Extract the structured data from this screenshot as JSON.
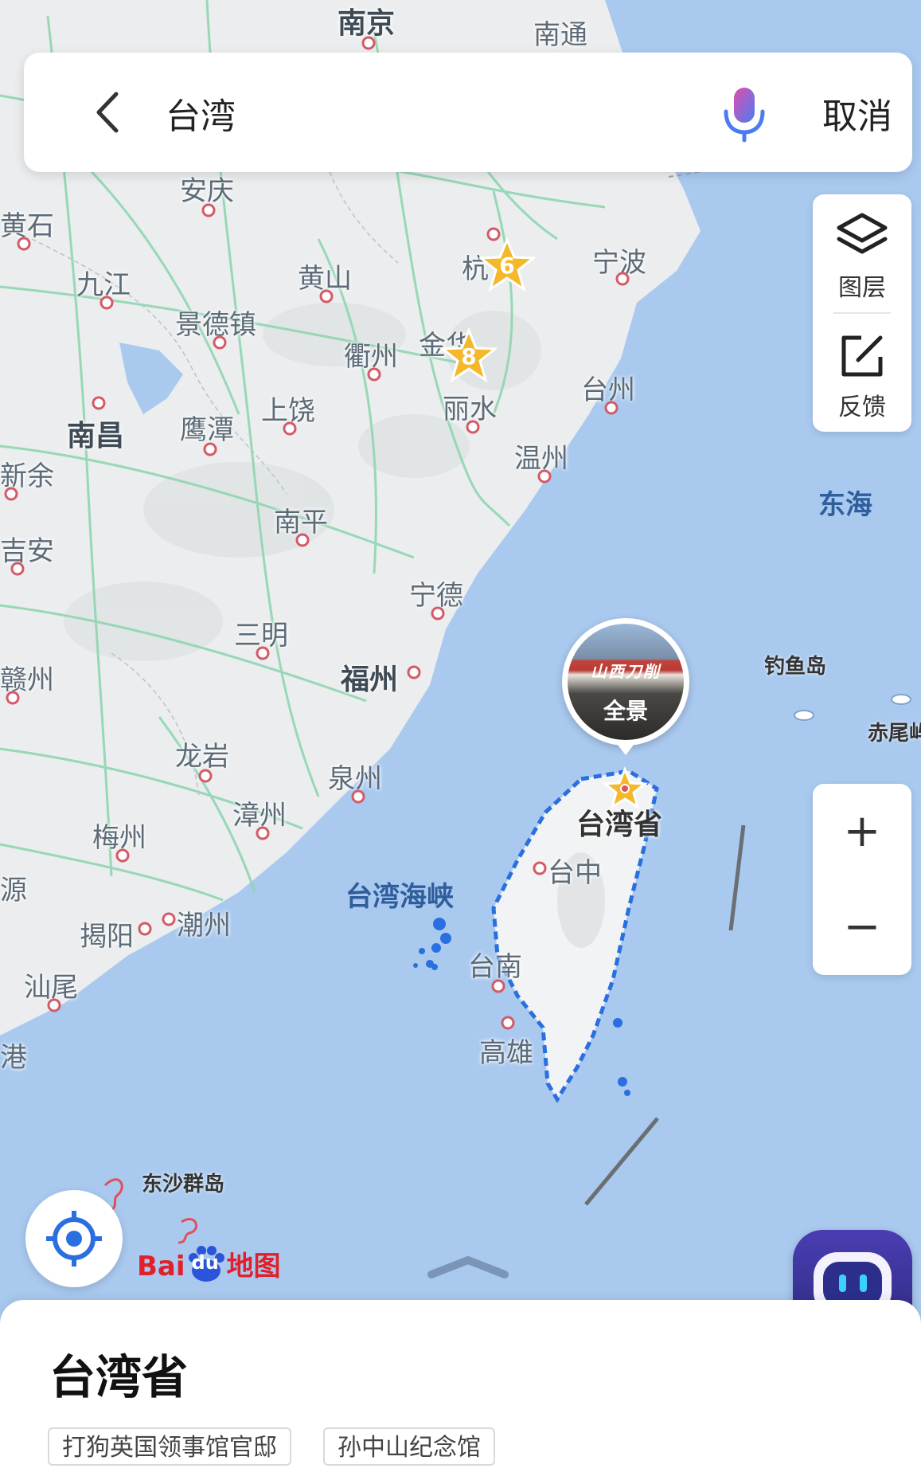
{
  "search": {
    "back_icon": "chevron-left-icon",
    "query": "台湾",
    "mic_icon": "microphone-icon",
    "cancel_label": "取消"
  },
  "side_panel": {
    "layers_icon": "layers-icon",
    "layers_label": "图层",
    "feedback_icon": "edit-icon",
    "feedback_label": "反馈"
  },
  "zoom": {
    "in_label": "+",
    "out_label": "−"
  },
  "map": {
    "cities": [
      "南京",
      "南通",
      "安庆",
      "黄石",
      "九江",
      "黄山",
      "杭",
      "宁波",
      "景德镇",
      "衢州",
      "金华",
      "台州",
      "南昌",
      "鹰潭",
      "上饶",
      "丽水",
      "温州",
      "新余",
      "南平",
      "吉安",
      "宁德",
      "三明",
      "赣州",
      "福州",
      "龙岩",
      "泉州",
      "漳州",
      "梅州",
      "源",
      "揭阳",
      "潮州",
      "汕尾",
      "港"
    ],
    "scenic_stars": [
      "6",
      "8"
    ],
    "sea_labels": [
      "东海",
      "台湾海峡"
    ],
    "islands": [
      "钓鱼岛",
      "赤尾屿",
      "东沙群岛"
    ],
    "province_label": "台湾省",
    "taiwan_cities": [
      "台中",
      "台南",
      "高雄"
    ],
    "panorama_label": "全景",
    "panorama_sign": "山西刀削"
  },
  "logo": {
    "part1": "Bai",
    "part2": "du",
    "part3": "地图"
  },
  "sheet": {
    "title": "台湾省",
    "tags": [
      "打狗英国领事馆官邸",
      "孙中山纪念馆"
    ]
  },
  "colors": {
    "land": "#eceeef",
    "sea": "#a9c9ef",
    "road": "#8fd6b0",
    "accent_blue": "#2a6fe0",
    "star": "#f5b82a"
  }
}
